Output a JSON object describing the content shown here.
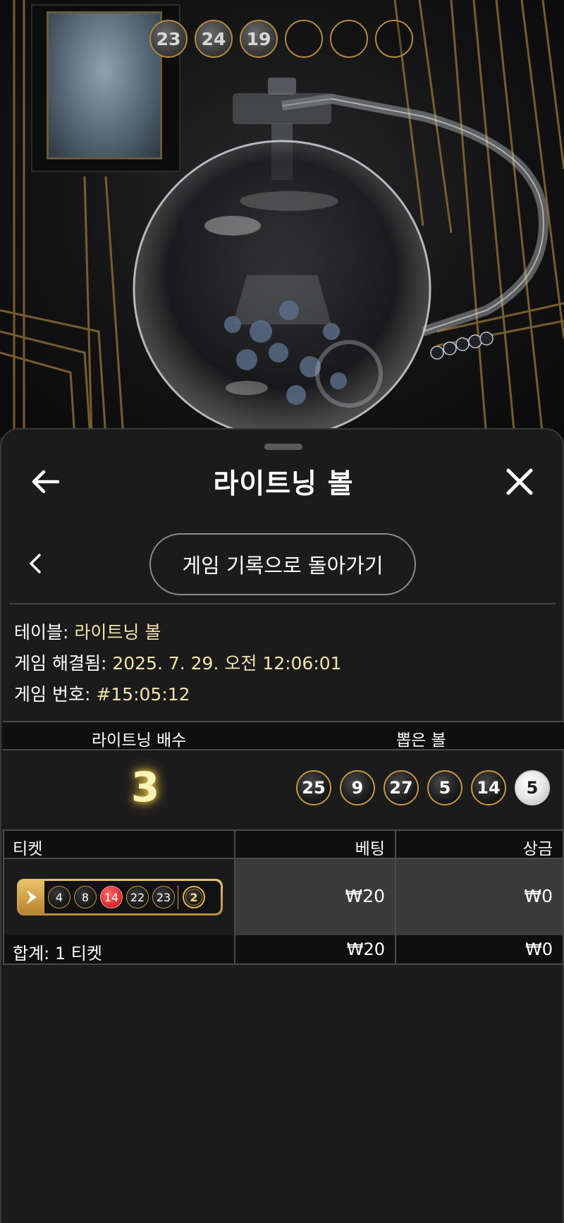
{
  "stream": {
    "drawn_balls": [
      "23",
      "24",
      "19",
      "",
      "",
      ""
    ]
  },
  "sheet": {
    "title": "라이트닝 볼",
    "history_button": "게임 기록으로 돌아가기"
  },
  "info": {
    "table_label": "테이블:",
    "table_value": "라이트닝 볼",
    "resolved_label": "게임 해결됨:",
    "resolved_value": "2025. 7. 29. 오전 12:06:01",
    "game_no_label": "게임 번호:",
    "game_no_value": "#15:05:12"
  },
  "result": {
    "multiplier_header": "라이트닝 배수",
    "balls_header": "뽑은 볼",
    "multiplier": "3",
    "balls": [
      "25",
      "9",
      "27",
      "5",
      "14",
      "5"
    ],
    "bonus_ball_index": 5
  },
  "tickets": {
    "headers": {
      "ticket": "티켓",
      "bet": "베팅",
      "win": "상금"
    },
    "rows": [
      {
        "numbers": [
          "4",
          "8",
          "14",
          "22",
          "23"
        ],
        "matched": [
          "14"
        ],
        "bonus": "2",
        "bet": "₩20",
        "win": "₩0"
      }
    ],
    "total": {
      "label": "합계: 1 티켓",
      "bet": "₩20",
      "win": "₩0"
    }
  },
  "colors": {
    "accent_gold": "#c9963e",
    "value_text": "#f4e3a8",
    "matched_ball": "#e23434"
  }
}
